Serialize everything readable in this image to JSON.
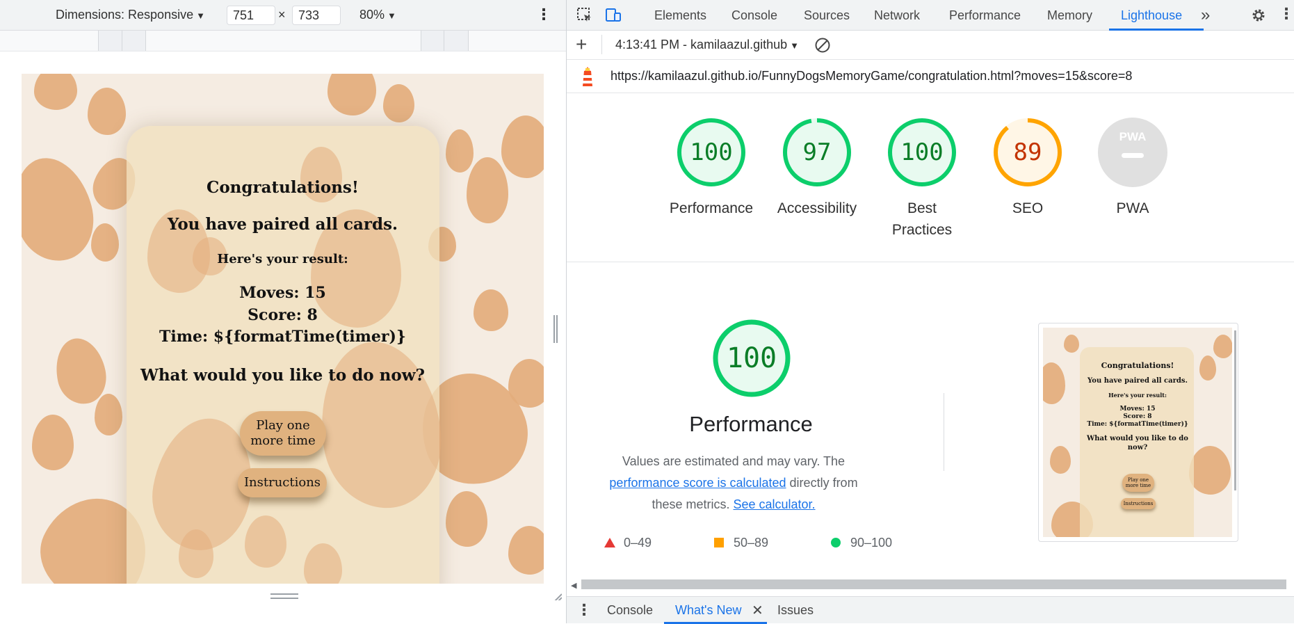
{
  "device_toolbar": {
    "dimensions_label": "Dimensions: Responsive",
    "width": "751",
    "times": "×",
    "height": "733",
    "zoom": "80%"
  },
  "page": {
    "heading1": "Congratulations!",
    "heading2": "You have paired all cards.",
    "result_intro": "Here's your result:",
    "moves": "Moves: 15",
    "score": "Score: 8",
    "time": "Time: ${formatTime(timer)}",
    "question": "What would you like to do now?",
    "play_button_line1": "Play one",
    "play_button_line2": "more time",
    "instructions_button": "Instructions"
  },
  "devtools": {
    "tabs": [
      "Elements",
      "Console",
      "Sources",
      "Network",
      "Performance",
      "Memory",
      "Lighthouse"
    ],
    "active_tab": "Lighthouse",
    "more_tabs": "»"
  },
  "lighthouse": {
    "report_selector": "4:13:41 PM - kamilaazul.github",
    "url": "https://kamilaazul.github.io/FunnyDogsMemoryGame/congratulation.html?moves=15&score=8",
    "scores": [
      {
        "value": "100",
        "label": "Performance",
        "status": "pass"
      },
      {
        "value": "97",
        "label": "Accessibility",
        "status": "pass"
      },
      {
        "value": "100",
        "label_line1": "Best",
        "label_line2": "Practices",
        "status": "pass"
      },
      {
        "value": "89",
        "label": "SEO",
        "status": "average"
      },
      {
        "value": "PWA",
        "label": "PWA",
        "status": "na"
      }
    ],
    "perf_score": "100",
    "perf_title": "Performance",
    "desc_prefix": "Values are estimated and may vary. The ",
    "desc_link1": "performance score is calculated",
    "desc_middle": " directly from these metrics. ",
    "desc_link2": "See calculator.",
    "legend": [
      {
        "range": "0–49",
        "shape": "triangle",
        "color": "#e53935"
      },
      {
        "range": "50–89",
        "shape": "square",
        "color": "#ffa000"
      },
      {
        "range": "90–100",
        "shape": "circle",
        "color": "#0cce6b"
      }
    ],
    "thumbnail": {
      "heading1": "Congratulations!",
      "heading2": "You have paired all cards.",
      "result_intro": "Here's your result:",
      "moves": "Moves: 15",
      "score": "Score: 8",
      "time": "Time: ${formatTime(timer)}",
      "question_line1": "What would you like to do",
      "question_line2": "now?",
      "play_line1": "Play one",
      "play_line2": "more time",
      "instructions": "Instructions"
    }
  },
  "drawer": {
    "tabs": [
      "Console",
      "What's New",
      "Issues"
    ],
    "active_tab": "What's New"
  },
  "colors": {
    "pass": "#0cce6b",
    "pass_text": "#0a7d27",
    "average": "#ffa400",
    "average_text": "#c33300",
    "na": "#e0e0e0",
    "accent": "#1a73e8",
    "paw": "#e3ad7c"
  }
}
